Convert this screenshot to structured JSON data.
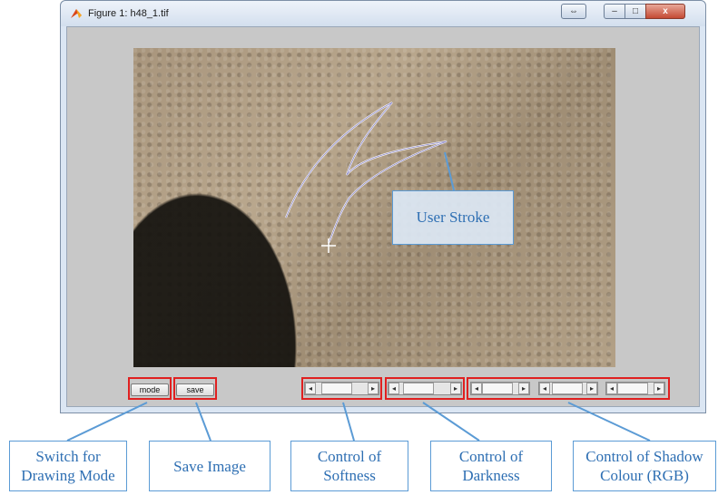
{
  "window": {
    "title": "Figure 1: h48_1.tif",
    "controls": {
      "minimize": "–",
      "maximize": "□",
      "close": "x"
    }
  },
  "buttons": {
    "mode": "mode",
    "save": "save"
  },
  "sliders": {
    "softness": {
      "value": 0.25
    },
    "darkness": {
      "value": 0.2
    },
    "red": {
      "value": 0.05
    },
    "green": {
      "value": 0.25
    },
    "blue": {
      "value": 0.05
    }
  },
  "annotations": {
    "user_stroke": "User Stroke",
    "mode_callout": [
      "Switch for",
      "Drawing Mode"
    ],
    "save_callout": "Save Image",
    "softness_callout": [
      "Control of",
      "Softness"
    ],
    "darkness_callout": [
      "Control of",
      "Darkness"
    ],
    "colour_callout": [
      "Control of Shadow",
      "Colour (RGB)"
    ]
  },
  "colors": {
    "highlight": "#e02020",
    "callout_text": "#2e6fb3",
    "callout_border": "#5b9bd5"
  }
}
